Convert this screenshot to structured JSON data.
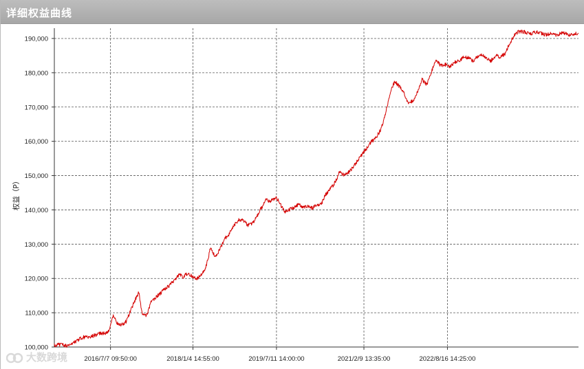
{
  "window": {
    "title": "详细权益曲线"
  },
  "watermark": {
    "text": "大数跨境"
  },
  "chart_data": {
    "type": "line",
    "title": "",
    "xlabel": "",
    "ylabel": "权益（P）",
    "ylim": [
      100000,
      193000
    ],
    "yticks": [
      {
        "value": 100000,
        "label": "100,000"
      },
      {
        "value": 110000,
        "label": "110,000"
      },
      {
        "value": 120000,
        "label": "120,000"
      },
      {
        "value": 130000,
        "label": "130,000"
      },
      {
        "value": 140000,
        "label": "140,000"
      },
      {
        "value": 150000,
        "label": "150,000"
      },
      {
        "value": 160000,
        "label": "160,000"
      },
      {
        "value": 170000,
        "label": "170,000"
      },
      {
        "value": 180000,
        "label": "180,000"
      },
      {
        "value": 190000,
        "label": "190,000"
      }
    ],
    "xlim": [
      "2015-07-01",
      "2024-12-31"
    ],
    "xticks": [
      {
        "value": "2016-07-07",
        "label": "2016/7/7 09:50:00"
      },
      {
        "value": "2018-01-04",
        "label": "2018/1/4 14:55:00"
      },
      {
        "value": "2019-07-11",
        "label": "2019/7/11 14:00:00"
      },
      {
        "value": "2021-02-09",
        "label": "2021/2/9 13:35:00"
      },
      {
        "value": "2022-08-16",
        "label": "2022/8/16 14:25:00"
      }
    ],
    "grid": true,
    "line_color": "#d40000",
    "series": [
      {
        "x": [
          "2015-07-01",
          "2015-08-15",
          "2015-10-01",
          "2015-11-15",
          "2016-01-01",
          "2016-02-15",
          "2016-04-01",
          "2016-05-01",
          "2016-06-01",
          "2016-06-20",
          "2016-07-07",
          "2016-07-25",
          "2016-08-20",
          "2016-09-20",
          "2016-10-20",
          "2016-11-15",
          "2016-12-10",
          "2017-01-10",
          "2017-02-01",
          "2017-03-01",
          "2017-04-01",
          "2017-05-01",
          "2017-06-01",
          "2017-07-01",
          "2017-08-01",
          "2017-09-01",
          "2017-10-01",
          "2017-11-01",
          "2017-12-01",
          "2018-01-04",
          "2018-02-01",
          "2018-03-01",
          "2018-04-01",
          "2018-05-01",
          "2018-06-01",
          "2018-07-01",
          "2018-08-01",
          "2018-09-01",
          "2018-10-01",
          "2018-11-01",
          "2018-12-01",
          "2019-01-01",
          "2019-02-01",
          "2019-03-01",
          "2019-04-01",
          "2019-05-01",
          "2019-06-01",
          "2019-07-11",
          "2019-08-01",
          "2019-09-01",
          "2019-10-01",
          "2019-11-01",
          "2019-12-01",
          "2020-01-01",
          "2020-02-01",
          "2020-03-01",
          "2020-04-01",
          "2020-05-01",
          "2020-06-01",
          "2020-07-01",
          "2020-08-01",
          "2020-09-01",
          "2020-10-01",
          "2020-11-01",
          "2020-12-01",
          "2021-01-01",
          "2021-02-09",
          "2021-03-01",
          "2021-04-01",
          "2021-05-01",
          "2021-06-01",
          "2021-07-01",
          "2021-08-01",
          "2021-09-01",
          "2021-10-01",
          "2021-11-01",
          "2021-12-01",
          "2022-01-01",
          "2022-02-01",
          "2022-03-01",
          "2022-04-01",
          "2022-05-01",
          "2022-06-01",
          "2022-07-01",
          "2022-08-16",
          "2022-09-01",
          "2022-10-01",
          "2022-11-01",
          "2022-12-01",
          "2023-01-01",
          "2023-02-01",
          "2023-03-01",
          "2023-04-01",
          "2023-05-01",
          "2023-06-01",
          "2023-07-01",
          "2023-08-01",
          "2023-09-01",
          "2023-10-01",
          "2023-11-01",
          "2023-12-01",
          "2024-01-01",
          "2024-02-01",
          "2024-03-01",
          "2024-04-01",
          "2024-05-01",
          "2024-06-01",
          "2024-07-01",
          "2024-08-01",
          "2024-09-01",
          "2024-10-01",
          "2024-11-01",
          "2024-12-31"
        ],
        "values": [
          100500,
          100800,
          100300,
          101500,
          102800,
          103000,
          103500,
          104000,
          104000,
          104200,
          106000,
          109500,
          107000,
          106500,
          107500,
          110500,
          113000,
          116000,
          110000,
          109000,
          113000,
          114500,
          115500,
          117000,
          118000,
          119500,
          121000,
          120500,
          121500,
          120500,
          120000,
          121000,
          123500,
          129000,
          126000,
          128500,
          131500,
          133000,
          135500,
          137000,
          137000,
          135500,
          136000,
          138000,
          140500,
          143000,
          142500,
          143500,
          142000,
          139500,
          140000,
          140500,
          141500,
          141000,
          141000,
          140500,
          141500,
          141500,
          144500,
          146000,
          148000,
          151000,
          150000,
          151000,
          152500,
          154500,
          157000,
          158000,
          160000,
          161000,
          163500,
          168000,
          174000,
          177500,
          176000,
          174000,
          171000,
          172000,
          174500,
          178000,
          176500,
          180000,
          184000,
          182000,
          182500,
          181500,
          183000,
          183500,
          184500,
          184500,
          183500,
          184500,
          185500,
          184000,
          183500,
          185000,
          184500,
          185500,
          188500,
          191000,
          192000,
          192000,
          191500,
          191500,
          192000,
          191500,
          191000,
          191500,
          191000,
          191500,
          191500,
          191000,
          191500
        ],
        "name": ""
      }
    ]
  }
}
